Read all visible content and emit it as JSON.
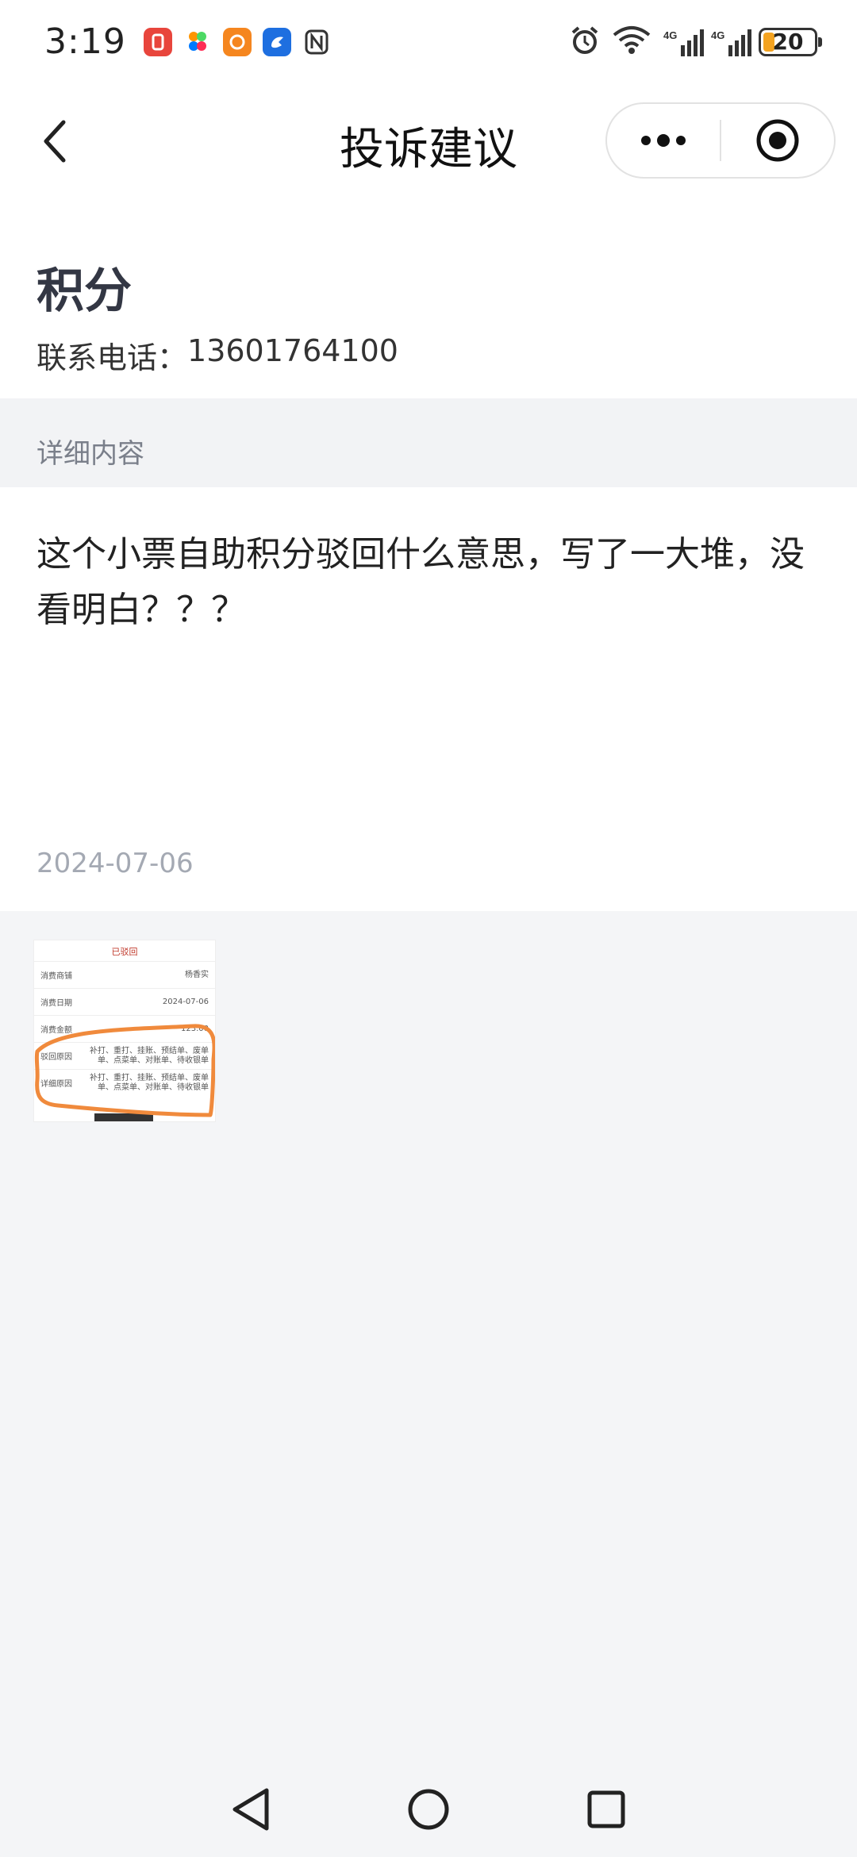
{
  "status_bar": {
    "time": "3:19",
    "battery_level": "20",
    "network_1": "4G",
    "network_2": "4G",
    "app_icons": [
      "red-app-icon",
      "pinwheel-app-icon",
      "orange-app-icon",
      "blue-app-icon",
      "nfc-icon"
    ]
  },
  "nav": {
    "title": "投诉建议",
    "back_icon": "chevron-left-icon",
    "more_icon": "more-dots-icon",
    "close_icon": "target-circle-icon"
  },
  "header": {
    "category": "积分",
    "contact_label": "联系电话：",
    "contact_phone": "13601764100"
  },
  "section": {
    "detail_label": "详细内容"
  },
  "content": {
    "text": "这个小票自助积分驳回什么意思，写了一大堆，没看明白？？？",
    "date": "2024-07-06"
  },
  "attachment": {
    "status": "已驳回",
    "rows": [
      {
        "label": "消费商铺",
        "value": "杨香实"
      },
      {
        "label": "消费日期",
        "value": "2024-07-06"
      },
      {
        "label": "消费金额",
        "value": "123.00"
      },
      {
        "label": "驳回原因",
        "value": "补打、重打、挂账、预结单、废单单、点菜单、对账单、待收银单"
      },
      {
        "label": "详细原因",
        "value": "补打、重打、挂账、预结单、废单单、点菜单、对账单、待收银单"
      }
    ],
    "highlight_color": "#f08a3c"
  },
  "colors": {
    "accent_battery": "#f4a320",
    "muted_text": "#a4a9b3",
    "section_text": "#7a7f8a"
  },
  "system_nav": [
    "back-triangle-icon",
    "home-circle-icon",
    "recents-square-icon"
  ]
}
